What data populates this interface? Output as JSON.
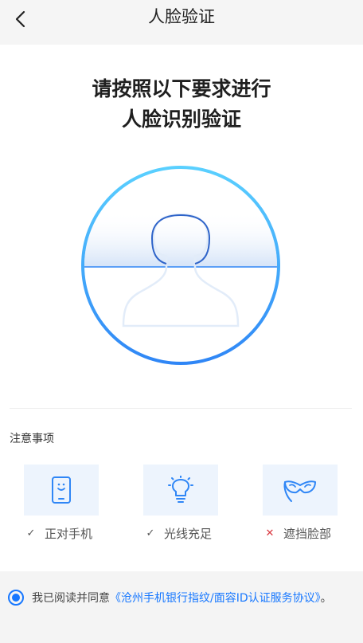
{
  "header": {
    "title": "人脸验证",
    "back_icon": "chevron-left-icon"
  },
  "instruction": {
    "line1": "请按照以下要求进行",
    "line2": "人脸识别验证"
  },
  "scanner": {
    "ring_colors": [
      "#3aa0ff",
      "#5ad0ff"
    ],
    "icon": "face-silhouette-icon"
  },
  "notes": {
    "title": "注意事项",
    "items": [
      {
        "label": "正对手机",
        "icon": "phone-face-icon",
        "status": "✓"
      },
      {
        "label": "光线充足",
        "icon": "lightbulb-icon",
        "status": "✓"
      },
      {
        "label": "遮挡脸部",
        "icon": "mask-icon",
        "status": "✕"
      }
    ]
  },
  "agreement": {
    "prefix": "我已阅读并同意",
    "link": "《沧州手机银行指纹/面容ID认证服务协议》",
    "suffix": "。",
    "checked": true
  },
  "colors": {
    "accent": "#1677ff",
    "tip_bg": "#edf4fd",
    "error": "#d9363e"
  }
}
